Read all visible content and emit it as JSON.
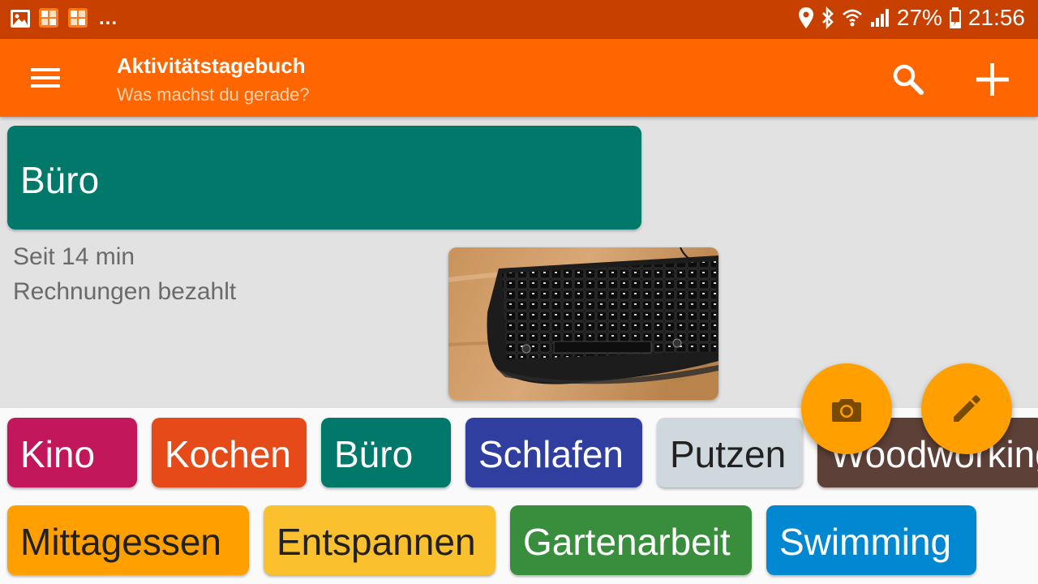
{
  "status_bar": {
    "overflow_text": "...",
    "battery": "27%",
    "time": "21:56"
  },
  "toolbar": {
    "title": "Aktivitätstagebuch",
    "subtitle": "Was machst du gerade?"
  },
  "current_activity": {
    "name": "Büro",
    "color": "#00796b",
    "duration": "Seit 14 min",
    "note": "Rechnungen bezahlt"
  },
  "activities": [
    {
      "label": "Kino",
      "color": "#c2185b",
      "text_color": "#ffffff"
    },
    {
      "label": "Kochen",
      "color": "#e64a19",
      "text_color": "#ffffff"
    },
    {
      "label": "Büro",
      "color": "#00796b",
      "text_color": "#ffffff"
    },
    {
      "label": "Schlafen",
      "color": "#303f9f",
      "text_color": "#ffffff"
    },
    {
      "label": "Putzen",
      "color": "#cfd8dc",
      "text_color": "#212121"
    },
    {
      "label": "Woodworking",
      "color": "#5d4037",
      "text_color": "#ffffff"
    },
    {
      "label": "Mittagessen",
      "color": "#ffa000",
      "text_color": "#212121"
    },
    {
      "label": "Entspannen",
      "color": "#fbc02d",
      "text_color": "#212121"
    },
    {
      "label": "Gartenarbeit",
      "color": "#388e3c",
      "text_color": "#ffffff"
    },
    {
      "label": "Swimming",
      "color": "#0288d1",
      "text_color": "#ffffff"
    }
  ],
  "colors": {
    "status_bar": "#c74000",
    "toolbar": "#ff6600",
    "fab": "#ffa000"
  }
}
